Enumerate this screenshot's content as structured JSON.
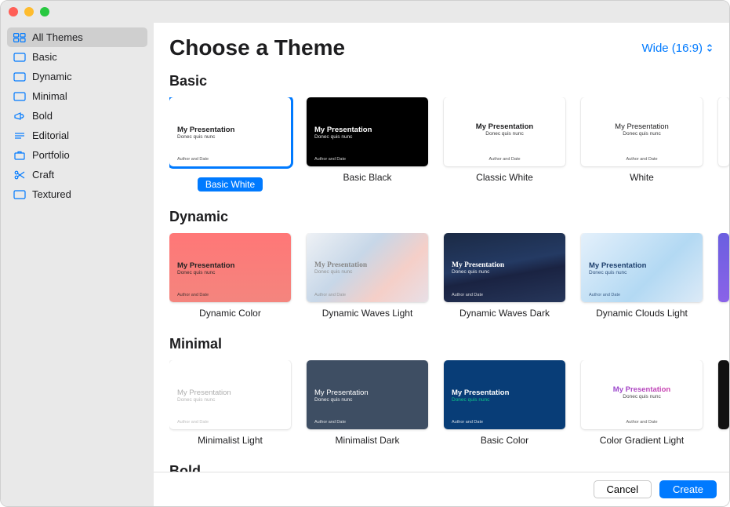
{
  "header": {
    "title": "Choose a Theme",
    "aspect_label": "Wide (16:9)"
  },
  "sidebar": {
    "items": [
      {
        "label": "All Themes"
      },
      {
        "label": "Basic"
      },
      {
        "label": "Dynamic"
      },
      {
        "label": "Minimal"
      },
      {
        "label": "Bold"
      },
      {
        "label": "Editorial"
      },
      {
        "label": "Portfolio"
      },
      {
        "label": "Craft"
      },
      {
        "label": "Textured"
      }
    ]
  },
  "thumb_sample": {
    "title": "My Presentation",
    "sub": "Donec quis nunc",
    "author": "Author and Date"
  },
  "sections": [
    {
      "title": "Basic",
      "themes": [
        {
          "label": "Basic White"
        },
        {
          "label": "Basic Black"
        },
        {
          "label": "Classic White"
        },
        {
          "label": "White"
        }
      ]
    },
    {
      "title": "Dynamic",
      "themes": [
        {
          "label": "Dynamic Color"
        },
        {
          "label": "Dynamic Waves Light"
        },
        {
          "label": "Dynamic Waves Dark"
        },
        {
          "label": "Dynamic Clouds Light"
        }
      ]
    },
    {
      "title": "Minimal",
      "themes": [
        {
          "label": "Minimalist Light"
        },
        {
          "label": "Minimalist Dark"
        },
        {
          "label": "Basic Color"
        },
        {
          "label": "Color Gradient Light"
        }
      ]
    },
    {
      "title": "Bold",
      "themes": []
    }
  ],
  "footer": {
    "cancel": "Cancel",
    "create": "Create"
  }
}
